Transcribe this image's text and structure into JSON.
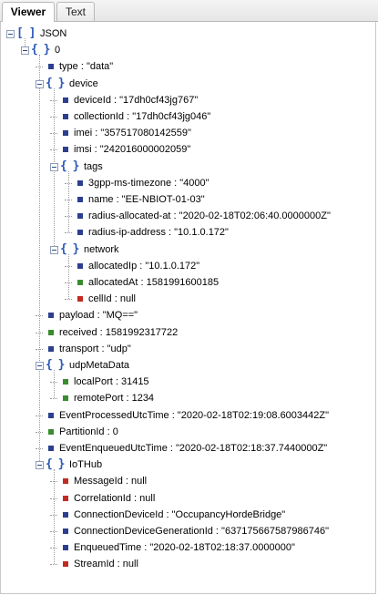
{
  "tabs": [
    {
      "label": "Viewer",
      "active": true
    },
    {
      "label": "Text",
      "active": false
    }
  ],
  "colors": {
    "string": "#2c3f8f",
    "number": "#3a8d2f",
    "null": "#c22b22",
    "bracket": "#2a58b8"
  },
  "tree": [
    {
      "label": "JSON",
      "kind": "array",
      "depth": 0
    },
    {
      "label": "0",
      "kind": "object",
      "depth": 1
    },
    {
      "label": "type : \"data\"",
      "kind": "string",
      "depth": 2
    },
    {
      "label": "device",
      "kind": "object",
      "depth": 2
    },
    {
      "label": "deviceId : \"17dh0cf43jg767\"",
      "kind": "string",
      "depth": 3
    },
    {
      "label": "collectionId : \"17dh0cf43jg046\"",
      "kind": "string",
      "depth": 3
    },
    {
      "label": "imei : \"357517080142559\"",
      "kind": "string",
      "depth": 3
    },
    {
      "label": "imsi : \"242016000002059\"",
      "kind": "string",
      "depth": 3
    },
    {
      "label": "tags",
      "kind": "object",
      "depth": 3
    },
    {
      "label": "3gpp-ms-timezone : \"4000\"",
      "kind": "string",
      "depth": 4
    },
    {
      "label": "name : \"EE-NBIOT-01-03\"",
      "kind": "string",
      "depth": 4
    },
    {
      "label": "radius-allocated-at : \"2020-02-18T02:06:40.0000000Z\"",
      "kind": "string",
      "depth": 4
    },
    {
      "label": "radius-ip-address : \"10.1.0.172\"",
      "kind": "string",
      "depth": 4
    },
    {
      "label": "network",
      "kind": "object",
      "depth": 3
    },
    {
      "label": "allocatedIp : \"10.1.0.172\"",
      "kind": "string",
      "depth": 4
    },
    {
      "label": "allocatedAt : 1581991600185",
      "kind": "number",
      "depth": 4
    },
    {
      "label": "cellId : null",
      "kind": "null",
      "depth": 4
    },
    {
      "label": "payload : \"MQ==\"",
      "kind": "string",
      "depth": 2
    },
    {
      "label": "received : 1581992317722",
      "kind": "number",
      "depth": 2
    },
    {
      "label": "transport : \"udp\"",
      "kind": "string",
      "depth": 2
    },
    {
      "label": "udpMetaData",
      "kind": "object",
      "depth": 2
    },
    {
      "label": "localPort : 31415",
      "kind": "number",
      "depth": 3
    },
    {
      "label": "remotePort : 1234",
      "kind": "number",
      "depth": 3
    },
    {
      "label": "EventProcessedUtcTime : \"2020-02-18T02:19:08.6003442Z\"",
      "kind": "string",
      "depth": 2
    },
    {
      "label": "PartitionId : 0",
      "kind": "number",
      "depth": 2
    },
    {
      "label": "EventEnqueuedUtcTime : \"2020-02-18T02:18:37.7440000Z\"",
      "kind": "string",
      "depth": 2
    },
    {
      "label": "IoTHub",
      "kind": "object",
      "depth": 2
    },
    {
      "label": "MessageId : null",
      "kind": "null",
      "depth": 3
    },
    {
      "label": "CorrelationId : null",
      "kind": "null",
      "depth": 3
    },
    {
      "label": "ConnectionDeviceId : \"OccupancyHordeBridge\"",
      "kind": "string",
      "depth": 3
    },
    {
      "label": "ConnectionDeviceGenerationId : \"637175667587986746\"",
      "kind": "string",
      "depth": 3
    },
    {
      "label": "EnqueuedTime : \"2020-02-18T02:18:37.0000000\"",
      "kind": "string",
      "depth": 3
    },
    {
      "label": "StreamId : null",
      "kind": "null",
      "depth": 3
    }
  ]
}
